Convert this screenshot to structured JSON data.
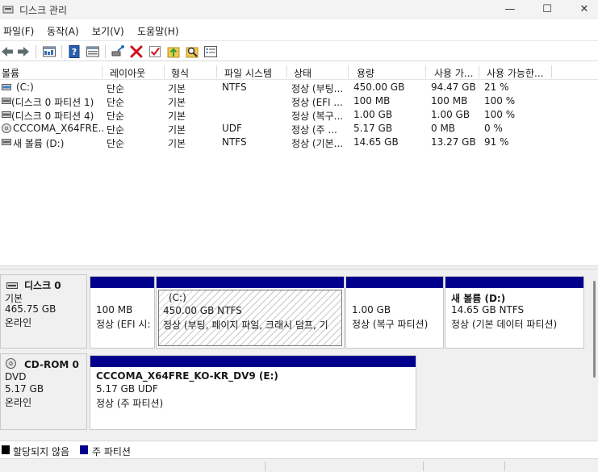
{
  "window": {
    "title": "디스크 관리",
    "minimize_glyph": "—",
    "maximize_glyph": "☐",
    "close_glyph": "✕"
  },
  "menu": [
    "파일(F)",
    "동작(A)",
    "보기(V)",
    "도움말(H)"
  ],
  "toolbar_icons": [
    "back-icon",
    "forward-icon",
    "disk-list-icon",
    "help-icon",
    "properties-icon",
    "connect-icon",
    "delete-icon",
    "check-icon",
    "up-icon",
    "search-icon",
    "list-icon"
  ],
  "columns": [
    "볼륨",
    "레이아웃",
    "형식",
    "파일 시스템",
    "상태",
    "용량",
    "사용 가...",
    "사용 가능한..."
  ],
  "volumes": [
    {
      "name": "(C:)",
      "layout": "단순",
      "type": "기본",
      "fs": "NTFS",
      "status": "정상 (부팅...",
      "capacity": "450.00 GB",
      "free": "94.47 GB",
      "pct": "21 %",
      "icon": "volume-icon"
    },
    {
      "name": "(디스크 0 파티션 1)",
      "layout": "단순",
      "type": "기본",
      "fs": "",
      "status": "정상 (EFI ...",
      "capacity": "100 MB",
      "free": "100 MB",
      "pct": "100 %",
      "icon": "volume-icon"
    },
    {
      "name": "(디스크 0 파티션 4)",
      "layout": "단순",
      "type": "기본",
      "fs": "",
      "status": "정상 (복구...",
      "capacity": "1.00 GB",
      "free": "1.00 GB",
      "pct": "100 %",
      "icon": "volume-icon"
    },
    {
      "name": "CCCOMA_X64FRE...",
      "layout": "단순",
      "type": "기본",
      "fs": "UDF",
      "status": "정상 (주 ...",
      "capacity": "5.17 GB",
      "free": "0 MB",
      "pct": "0 %",
      "icon": "cd-icon"
    },
    {
      "name": "새 볼륨 (D:)",
      "layout": "단순",
      "type": "기본",
      "fs": "NTFS",
      "status": "정상 (기본...",
      "capacity": "14.65 GB",
      "free": "13.27 GB",
      "pct": "91 %",
      "icon": "volume-icon"
    }
  ],
  "disks": [
    {
      "name": "디스크 0",
      "kind": "기본",
      "size": "465.75 GB",
      "state": "온라인",
      "partitions": [
        {
          "name": "",
          "size": "100 MB",
          "status": "정상 (EFI 시:"
        },
        {
          "name": "(C:)",
          "size": "450.00 GB NTFS",
          "status": "정상 (부팅, 페이지 파일, 크래시 덤프, 기"
        },
        {
          "name": "",
          "size": "1.00 GB",
          "status": "정상 (복구 파티션)"
        },
        {
          "name": "새 볼륨  (D:)",
          "size": "14.65 GB NTFS",
          "status": "정상 (기본 데이터 파티션)"
        }
      ]
    },
    {
      "name": "CD-ROM 0",
      "kind": "DVD",
      "size": "5.17 GB",
      "state": "온라인",
      "partitions": [
        {
          "name": "CCCOMA_X64FRE_KO-KR_DV9  (E:)",
          "size": "5.17 GB UDF",
          "status": "정상 (주 파티션)"
        }
      ]
    }
  ],
  "legend": [
    {
      "label": "할당되지 않음",
      "color": "#000000"
    },
    {
      "label": "주 파티션",
      "color": "#00008c"
    }
  ],
  "colors": {
    "primary_partition": "#00008c",
    "unallocated": "#000000"
  }
}
